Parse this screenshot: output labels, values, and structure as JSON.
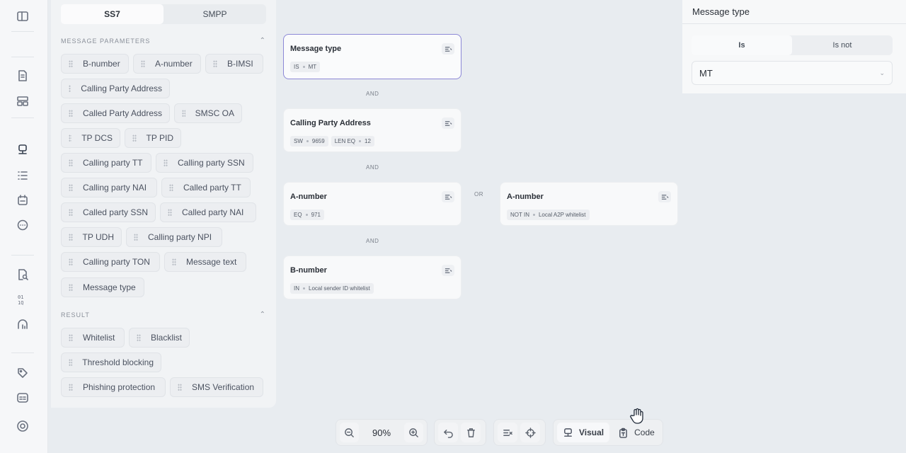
{
  "tabs": {
    "ss7": "SS7",
    "smpp": "SMPP"
  },
  "sections": {
    "params": "MESSAGE PARAMETERS",
    "result": "RESULT"
  },
  "params": [
    "B-number",
    "A-number",
    "B-IMSI",
    "Calling Party Address",
    "Called Party Address",
    "SMSC OA",
    "TP DCS",
    "TP PID",
    "Calling party TT",
    "Calling party SSN",
    "Calling party NAI",
    "Called party TT",
    "Called party SSN",
    "Called party NAI",
    "TP UDH",
    "Calling party NPI",
    "Calling party TON",
    "Message text",
    "Message type"
  ],
  "results": [
    "Whitelist",
    "Blacklist",
    "Threshold blocking",
    "Phishing protection",
    "SMS Verification"
  ],
  "nodes": {
    "message_type": {
      "title": "Message type",
      "op": "IS",
      "val": "MT"
    },
    "calling_party": {
      "title": "Calling Party Address",
      "op1": "SW",
      "val1": "9659",
      "op2": "LEN EQ",
      "val2": "12"
    },
    "a_number": {
      "title": "A-number",
      "op": "EQ",
      "val": "971"
    },
    "a_number_or": {
      "title": "A-number",
      "op": "NOT IN",
      "val": "Local A2P whitelist"
    },
    "b_number": {
      "title": "B-number",
      "op": "IN",
      "val": "Local sender ID whitelist"
    }
  },
  "joins": {
    "and1": "AND",
    "and2": "AND",
    "or": "OR",
    "and3": "AND"
  },
  "inspector": {
    "title": "Message type",
    "is": "Is",
    "is_not": "Is not",
    "value": "MT"
  },
  "toolbar": {
    "zoom": "90%",
    "visual": "Visual",
    "code": "Code"
  },
  "colors": {
    "selected_border": "#8c88d6",
    "canvas": "#e8ecf0"
  }
}
